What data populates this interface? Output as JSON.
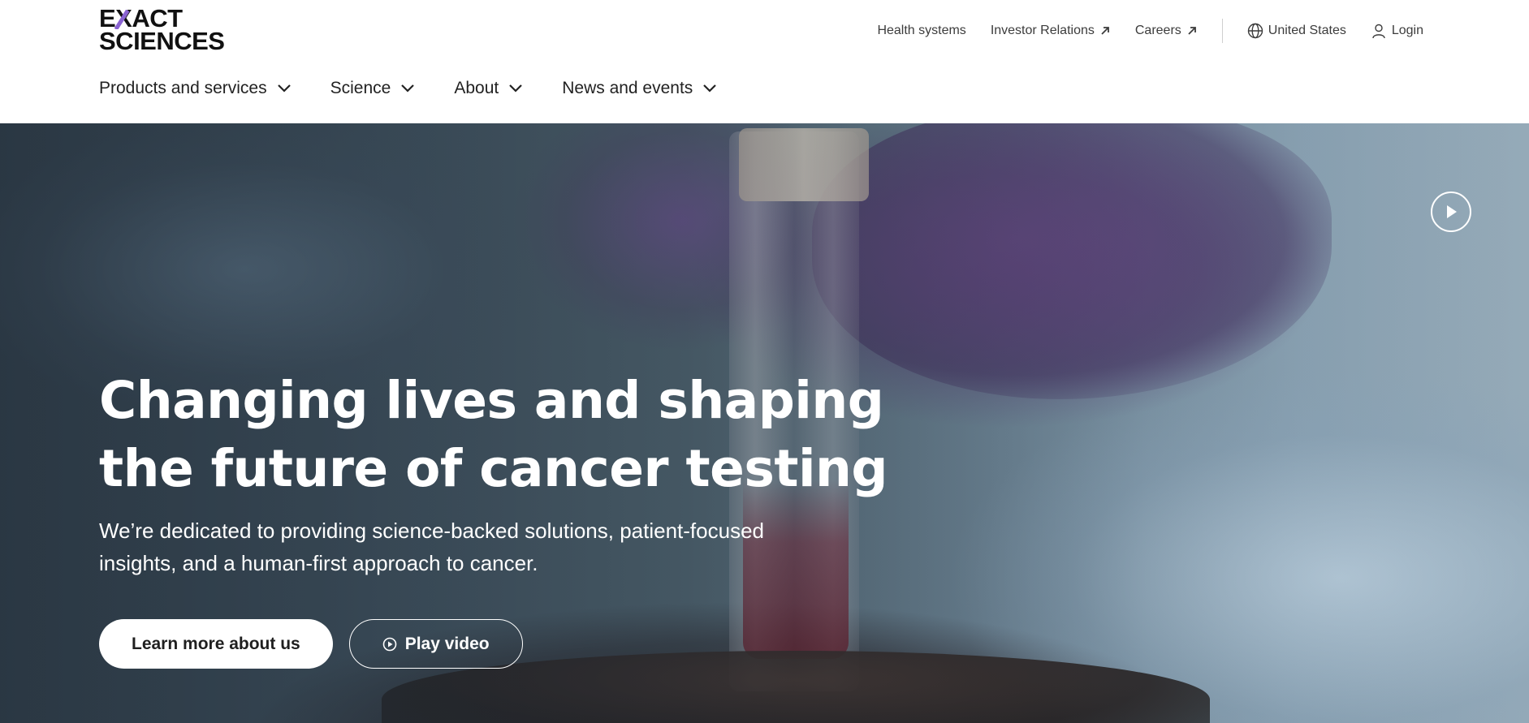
{
  "brand": {
    "logo_line1": "EXACT",
    "logo_line2": "SCIENCES",
    "logo_accent_color": "#8a63d2"
  },
  "utility_nav": {
    "items": [
      {
        "label": "Health systems",
        "icon": null
      },
      {
        "label": "Investor Relations",
        "icon": "external-arrow-icon"
      },
      {
        "label": "Careers",
        "icon": "external-arrow-icon"
      }
    ],
    "region": {
      "label": "United States",
      "icon": "globe-icon"
    },
    "login": {
      "label": "Login",
      "icon": "user-icon"
    }
  },
  "main_nav": {
    "items": [
      {
        "label": "Products and services",
        "icon": "chevron-down-icon"
      },
      {
        "label": "Science",
        "icon": "chevron-down-icon"
      },
      {
        "label": "About",
        "icon": "chevron-down-icon"
      },
      {
        "label": "News and events",
        "icon": "chevron-down-icon"
      }
    ]
  },
  "hero": {
    "title_line1": "Changing lives and shaping",
    "title_line2": "the future of cancer testing",
    "subtitle_line1": "We’re dedicated to providing science-backed solutions, patient-focused",
    "subtitle_line2": "insights, and a human-first approach to cancer.",
    "primary_button": "Learn more about us",
    "secondary_button": "Play video",
    "secondary_icon": "play-circle-icon",
    "corner_control_icon": "play-icon"
  }
}
